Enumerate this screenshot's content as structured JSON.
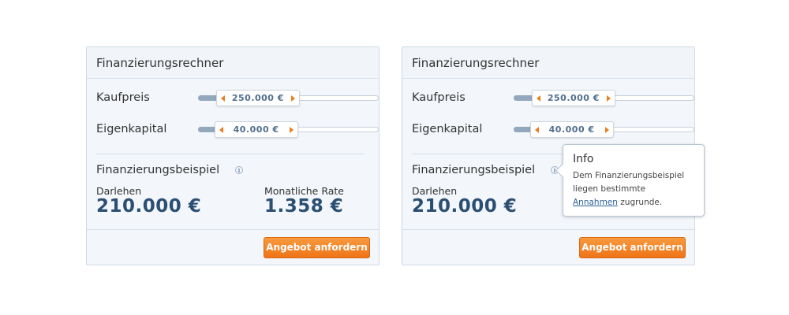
{
  "left_card": {
    "title": "Finanzierungsrechner",
    "purchase_price": {
      "label": "Kaufpreis",
      "value": "250.000 €",
      "level_pct": 33
    },
    "equity": {
      "label": "Eigenkapital",
      "value": "40.000 €",
      "level_pct": 9
    },
    "example_title": "Finanzierungsbeispiel",
    "info_icon": "i",
    "loan_label": "Darlehen",
    "loan_value": "210.000 €",
    "rate_label": "Monatliche Rate",
    "rate_value": "1.358 €",
    "cta_label": "Angebot anfordern"
  },
  "right_card": {
    "title": "Finanzierungsrechner",
    "purchase_price": {
      "label": "Kaufpreis",
      "value": "250.000 €",
      "level_pct": 33
    },
    "equity": {
      "label": "Eigenkapital",
      "value": "40.000 €",
      "level_pct": 9
    },
    "example_title": "Finanzierungsbeispiel",
    "info_icon": "i",
    "loan_label": "Darlehen",
    "loan_value": "210.000 €",
    "cta_label": "Angebot anfordern"
  },
  "tooltip": {
    "title": "Info",
    "line1": "Dem Finanzierungsbeispiel",
    "line2": "liegen bestimmte",
    "link": "Annahmen",
    "line3_rest": " zugrunde."
  },
  "colors": {
    "accent": "#ef7418",
    "value_blue": "#2b4f72",
    "slider_fill": "#93a7bd"
  }
}
